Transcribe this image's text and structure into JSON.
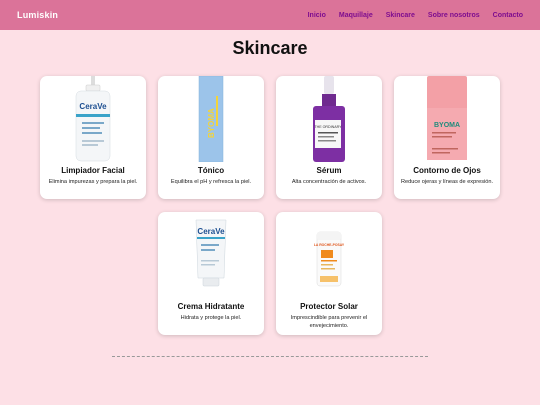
{
  "brand": "Lumiskin",
  "nav": [
    "Inicio",
    "Maquillaje",
    "Skincare",
    "Sobre nosotros",
    "Contacto"
  ],
  "page_title": "Skincare",
  "products": [
    {
      "name": "Limpiador Facial",
      "desc": "Elimina impurezas y prepara la piel.",
      "image_text": "CeraVe"
    },
    {
      "name": "Tónico",
      "desc": "Equilibra el pH y refresca la piel.",
      "image_text": "BYOMA"
    },
    {
      "name": "Sérum",
      "desc": "Alta concentración de activos.",
      "image_text": "THE ORDINARY"
    },
    {
      "name": "Contorno de Ojos",
      "desc": "Reduce ojeras y líneas de expresión.",
      "image_text": "BYOMA"
    },
    {
      "name": "Crema Hidratante",
      "desc": "Hidrata y protege la piel.",
      "image_text": "CeraVe"
    },
    {
      "name": "Protector Solar",
      "desc": "Imprescindible para prevenir el envejecimiento.",
      "image_text": "LA ROCHE-POSAY"
    }
  ]
}
